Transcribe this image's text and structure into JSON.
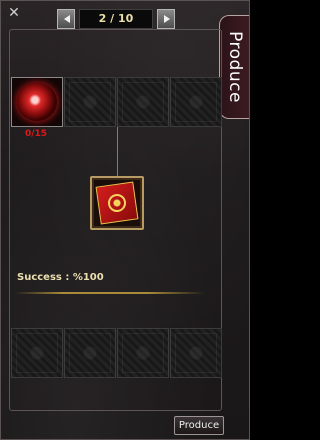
{
  "header": {
    "close_glyph": "✕",
    "page_indicator": "2 / 10"
  },
  "side_tab": {
    "label": "Produce"
  },
  "materials": [
    {
      "state": "filled",
      "icon": "red-orb-icon",
      "count": "0/15"
    },
    {
      "state": "empty"
    },
    {
      "state": "empty"
    },
    {
      "state": "empty"
    }
  ],
  "result": {
    "icon": "red-card-icon"
  },
  "success_text": "Success : %100",
  "output_slots": 4,
  "produce_button": {
    "label": "Produce"
  },
  "colors": {
    "accent_gold": "#a88a38",
    "count_red": "#e01818",
    "text_cream": "#ecdfb0"
  }
}
